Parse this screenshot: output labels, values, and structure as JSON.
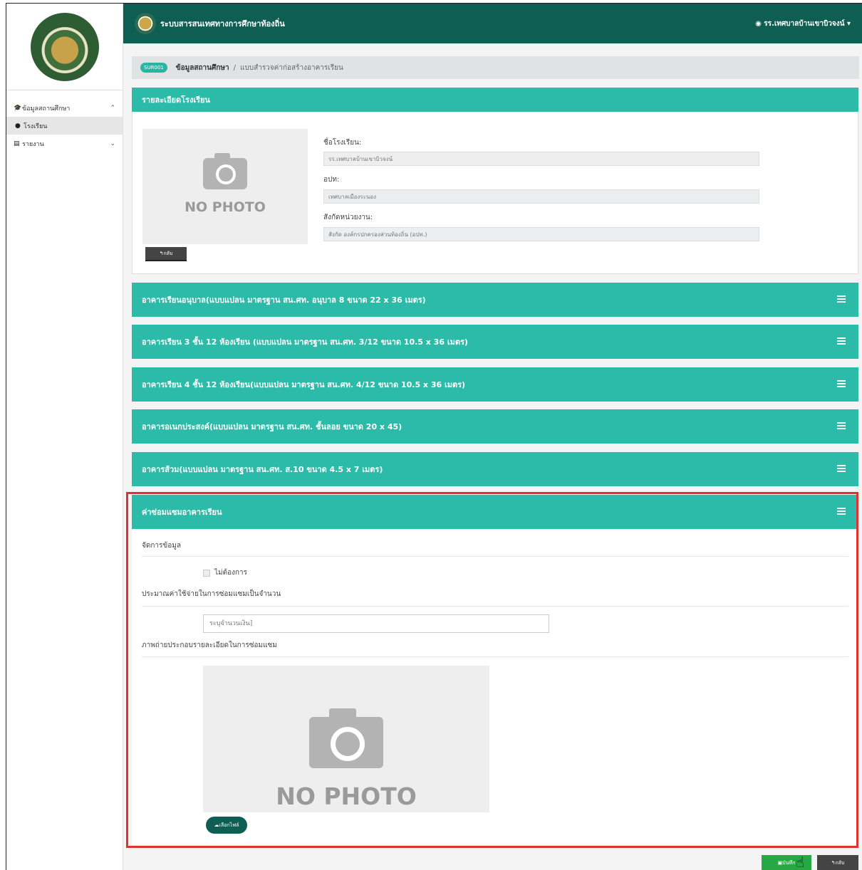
{
  "app": {
    "title": "ระบบสารสนเทศทางการศึกษาท้องถิ่น",
    "user": "รร.เทศบาลบ้านเขาบิวจงน์"
  },
  "sidebar": {
    "items": [
      {
        "label": "ข้อมูลสถานศึกษา",
        "icon": "graduation-cap-icon"
      },
      {
        "label": "โรงเรียน",
        "icon": "dot-icon"
      },
      {
        "label": "รายงาน",
        "icon": "file-icon"
      }
    ]
  },
  "breadcrumb": {
    "badge": "SUR001",
    "level1": "ข้อมูลสถานศึกษา",
    "separator": "/",
    "level2": "แบบสำรวจค่าก่อสร้างอาคารเรียน"
  },
  "school": {
    "header": "รายละเอียดโรงเรียน",
    "photo_text": "NO PHOTO",
    "back_label": "กลับ",
    "fields": [
      {
        "label": "ชื่อโรงเรียน:",
        "value": "รร.เทศบาลบ้านเขาบิวจงน์"
      },
      {
        "label": "อปท:",
        "value": "เทศบาลเมืองระนอง"
      },
      {
        "label": "สังกัดหน่วยงาน:",
        "value": "สังกัด องค์กรปกครองส่วนท้องถิ่น (อปท.)"
      }
    ]
  },
  "sections": [
    "อาคารเรียนอนุบาล(แบบแปลน มาตรฐาน สน.ศท. อนุบาล 8 ขนาด 22 x 36 เมตร)",
    "อาคารเรียน 3 ชั้น 12 ห้องเรียน (แบบแปลน มาตรฐาน สน.ศท. 3/12 ขนาด 10.5 x 36 เมตร)",
    "อาคารเรียน 4 ชั้น 12 ห้องเรียน(แบบแปลน มาตรฐาน สน.ศท. 4/12 ขนาด 10.5 x 36 เมตร)",
    "อาคารอเนกประสงค์(แบบแปลน มาตรฐาน สน.ศท. ชั้นลอย ขนาด 20 x 45)",
    "อาคารส้วม(แบบแปลน มาตรฐาน สน.ศท. ส.10 ขนาด 4.5 x 7 เมตร)"
  ],
  "repair": {
    "header": "ค่าซ่อมแซมอาคารเรียน",
    "manage_label": "จัดการข้อมูล",
    "not_needed_label": "ไม่ต้องการ",
    "budget_label": "ประมาณค่าใช้จ่ายในการซ่อมแซมเป็นจำนวน",
    "amount_placeholder": "ระบุจำนวนเงิน]",
    "photo_label": "ภาพถ่ายประกอบรายละเอียดในการซ่อมแซม",
    "photo_text": "NO PHOTO",
    "upload_label": "เลือกไฟล์"
  },
  "actions": {
    "save_label": "บันทึก",
    "back_label": "กลับ"
  }
}
